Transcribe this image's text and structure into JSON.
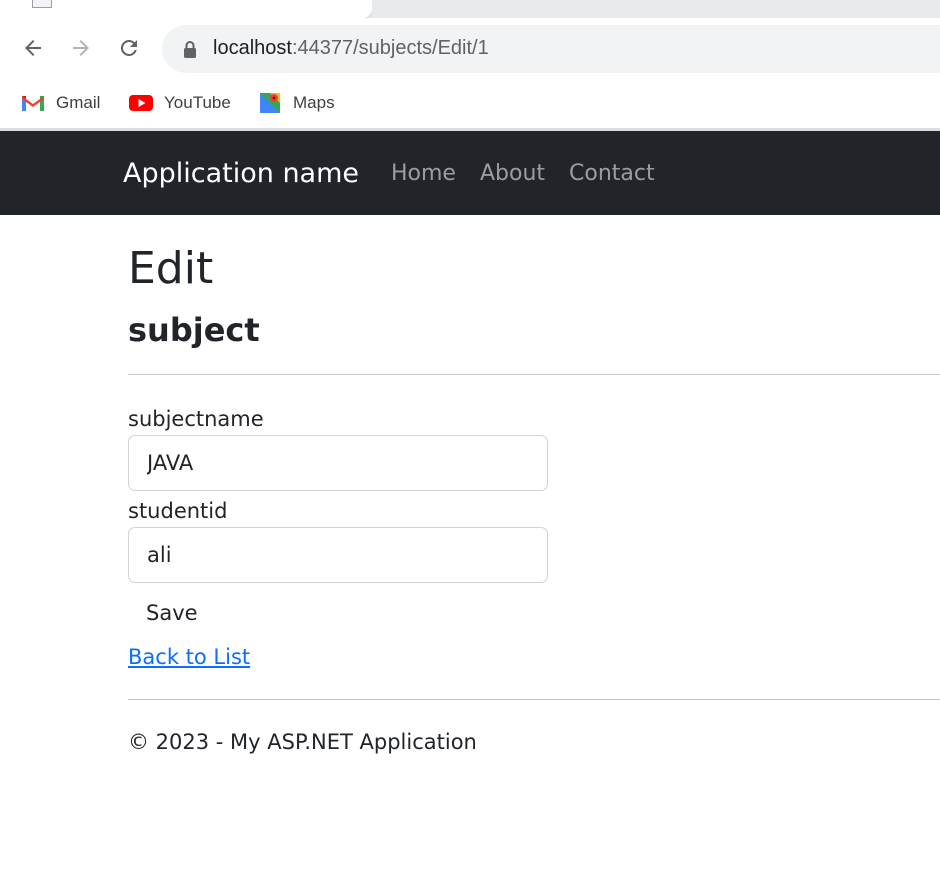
{
  "browser": {
    "url_host": "localhost",
    "url_path": ":44377/subjects/Edit/1",
    "bookmarks": [
      {
        "label": "Gmail",
        "icon": "gmail-icon"
      },
      {
        "label": "YouTube",
        "icon": "youtube-icon"
      },
      {
        "label": "Maps",
        "icon": "maps-icon"
      }
    ]
  },
  "navbar": {
    "brand": "Application name",
    "links": [
      "Home",
      "About",
      "Contact"
    ],
    "background": "#212529"
  },
  "page": {
    "title": "Edit",
    "subtitle": "subject"
  },
  "form": {
    "subjectname_label": "subjectname",
    "subjectname_value": "JAVA",
    "studentid_label": "studentid",
    "studentid_value": "ali",
    "save_label": "Save"
  },
  "back_link": "Back to List",
  "footer": "© 2023 - My ASP.NET Application",
  "colors": {
    "link": "#0d6efd",
    "text": "#212529"
  }
}
